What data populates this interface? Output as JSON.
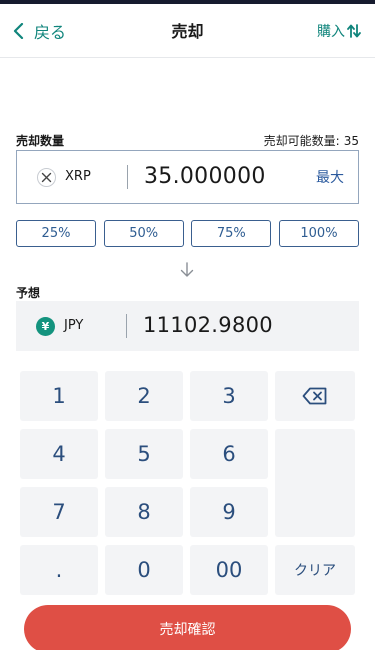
{
  "header": {
    "back_label": "戻る",
    "title": "売却",
    "buy_label": "購入"
  },
  "sell": {
    "quantity_label": "売却数量",
    "available_label": "売却可能数量:",
    "available_value": "35",
    "coin_icon": "xrp-icon",
    "coin_name": "XRP",
    "quantity_value": "35.000000",
    "max_label": "最大",
    "percent_buttons": [
      "25%",
      "50%",
      "75%",
      "100%"
    ]
  },
  "expected": {
    "label": "予想",
    "currency_icon": "yen-icon",
    "currency_symbol": "¥",
    "currency_name": "JPY",
    "value": "11102.9800"
  },
  "keypad": {
    "keys": [
      "1",
      "2",
      "3",
      "4",
      "5",
      "6",
      "7",
      "8",
      "9",
      ".",
      "0",
      "00"
    ],
    "clear_label": "クリア",
    "backspace_icon": "backspace-icon"
  },
  "confirm_label": "売却確認",
  "colors": {
    "accent_green": "#10857c",
    "primary_blue": "#2f5d92",
    "confirm_red": "#df4f45",
    "jpy_badge": "#14937e"
  }
}
